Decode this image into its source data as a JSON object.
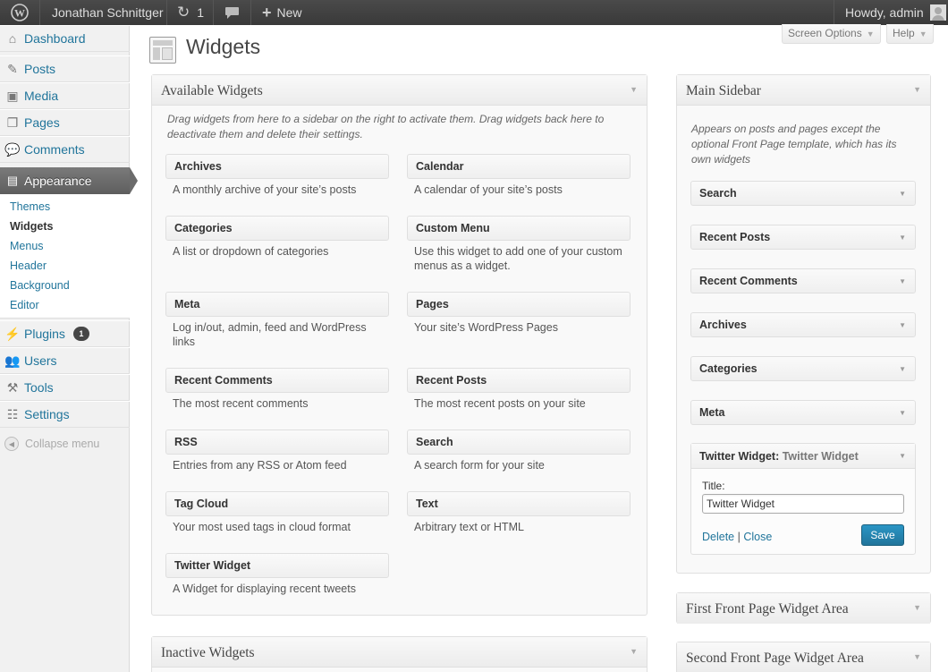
{
  "adminbar": {
    "site_name": "Jonathan Schnittger",
    "updates_count": "1",
    "new_label": "New",
    "howdy": "Howdy, admin"
  },
  "sidebar": {
    "items": [
      {
        "label": "Dashboard",
        "icon": "dashboard-icon"
      },
      {
        "label": "Posts",
        "icon": "posts-icon"
      },
      {
        "label": "Media",
        "icon": "media-icon"
      },
      {
        "label": "Pages",
        "icon": "pages-icon"
      },
      {
        "label": "Comments",
        "icon": "comments-icon"
      },
      {
        "label": "Appearance",
        "icon": "appearance-icon"
      },
      {
        "label": "Plugins",
        "icon": "plugins-icon",
        "badge": "1"
      },
      {
        "label": "Users",
        "icon": "users-icon"
      },
      {
        "label": "Tools",
        "icon": "tools-icon"
      },
      {
        "label": "Settings",
        "icon": "settings-icon"
      }
    ],
    "appearance_sub": [
      "Themes",
      "Widgets",
      "Menus",
      "Header",
      "Background",
      "Editor"
    ],
    "collapse": "Collapse menu"
  },
  "header": {
    "title": "Widgets",
    "screen_options": "Screen Options",
    "help": "Help"
  },
  "available": {
    "title": "Available Widgets",
    "description": "Drag widgets from here to a sidebar on the right to activate them. Drag widgets back here to deactivate them and delete their settings.",
    "widgets": [
      {
        "name": "Archives",
        "desc": "A monthly archive of your site’s posts"
      },
      {
        "name": "Calendar",
        "desc": "A calendar of your site’s posts"
      },
      {
        "name": "Categories",
        "desc": "A list or dropdown of categories"
      },
      {
        "name": "Custom Menu",
        "desc": "Use this widget to add one of your custom menus as a widget."
      },
      {
        "name": "Meta",
        "desc": "Log in/out, admin, feed and WordPress links"
      },
      {
        "name": "Pages",
        "desc": "Your site’s WordPress Pages"
      },
      {
        "name": "Recent Comments",
        "desc": "The most recent comments"
      },
      {
        "name": "Recent Posts",
        "desc": "The most recent posts on your site"
      },
      {
        "name": "RSS",
        "desc": "Entries from any RSS or Atom feed"
      },
      {
        "name": "Search",
        "desc": "A search form for your site"
      },
      {
        "name": "Tag Cloud",
        "desc": "Your most used tags in cloud format"
      },
      {
        "name": "Text",
        "desc": "Arbitrary text or HTML"
      },
      {
        "name": "Twitter Widget",
        "desc": "A Widget for displaying recent tweets"
      }
    ]
  },
  "inactive": {
    "title": "Inactive Widgets"
  },
  "main_sidebar": {
    "title": "Main Sidebar",
    "description": "Appears on posts and pages except the optional Front Page template, which has its own widgets",
    "widgets": [
      "Search",
      "Recent Posts",
      "Recent Comments",
      "Archives",
      "Categories",
      "Meta"
    ],
    "twitter": {
      "name": "Twitter Widget:",
      "instance": "Twitter Widget",
      "title_label": "Title:",
      "title_value": "Twitter Widget",
      "delete": "Delete",
      "sep": "|",
      "close": "Close",
      "save": "Save"
    }
  },
  "first_front": {
    "title": "First Front Page Widget Area"
  },
  "second_front": {
    "title": "Second Front Page Widget Area"
  }
}
